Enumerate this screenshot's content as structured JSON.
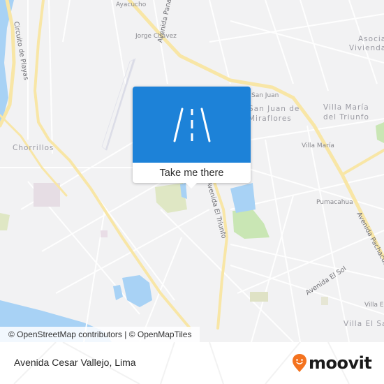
{
  "map": {
    "labels": {
      "ayacucho": "Ayacucho",
      "jorge_chavez": "Jorge Chávez",
      "panamericana": "Avenida Panamericana Sur",
      "circuito": "Circuito de Playas",
      "chorrillos": "Chorrillos",
      "san_juan": "San Juan",
      "sjm_1": "San Juan de",
      "sjm_2": "Miraflores",
      "vmt_1": "Villa María",
      "vmt_2": "del Triunfo",
      "villa_maria": "Villa María",
      "asoc_1": "Asocia",
      "asoc_2": "Vivienda",
      "el_triunfo": "Avenida El Triunfo",
      "pumacahua": "Pumacahua",
      "pachacutec": "Avenida Pachacutec",
      "el_sol": "Avenida El Sol",
      "villa_el_1": "Villa El",
      "villa_el_salvador": "Villa El Salvador"
    },
    "colors": {
      "background": "#f2f2f3",
      "major_road": "#f8e6a6",
      "water": "#a8d2f5",
      "park": "#c9e6b4",
      "popup_blue": "#1d82d8"
    }
  },
  "popup": {
    "icon": "road-icon",
    "action_label": "Take me there"
  },
  "attribution": "© OpenStreetMap contributors | © OpenMapTiles",
  "footer": {
    "place_name": "Avenida Cesar Vallejo, Lima",
    "brand": "moovit",
    "brand_color": "#f4731f"
  }
}
